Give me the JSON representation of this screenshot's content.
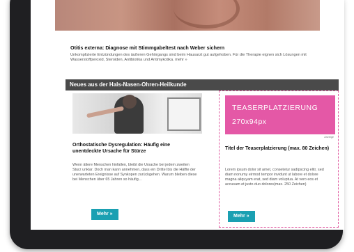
{
  "article": {
    "title": "Otitis externa: Diagnose mit Stimmgabeltest nach Weber sichern",
    "body": "Unkomplizierte Entzündungen des äußeren Gehörgangs sind beim Hausarzt gut aufgehoben. Für die Therapie eignen sich Lösungen mit Wasserstoffperoxid, Steroiden, Antibiotika und Antimykotika. mehr »"
  },
  "section": {
    "title": "Neues aus der Hals-Nasen-Ohren-Heilkunde"
  },
  "left_card": {
    "title": "Orthostatische Dysregulation: Häufig eine unentdeckte Ursache für Stürze",
    "body": "Wenn ältere Menschen hinfallen, bleibt die Ursache bei jedem zweiten Sturz unklar. Doch man kann annehmen, dass ein Drittel bis die Hälfte der unerwarteten Ereignisse auf Synkopen zurückgehen. Warum bleiben diese bei Menschen über 65 Jahren so häufig...",
    "button": "Mehr »"
  },
  "right_card": {
    "ad_line1": "TEASERPLATZIERUNG",
    "ad_line2": "270x94px",
    "ad_label": "Anzeige",
    "ad_color": "#e458a6",
    "title": "Titel der Teaserplatzierung (max. 80 Zeichen)",
    "body": "Lorem ipsum dolor sit amet, consetetur sadipscing elitr, sed diam nonumy eirmod tempor invidunt ut labore et dolore magna aliquyam erat, sed diam voluptua. At vero eos et accusam et justo duo dolores(max. 250 Zeichen)",
    "button": "Mehr »"
  },
  "colors": {
    "section_bar": "#4a4a4a",
    "button": "#1aa0b2",
    "teaser_border": "#e05aa0"
  }
}
